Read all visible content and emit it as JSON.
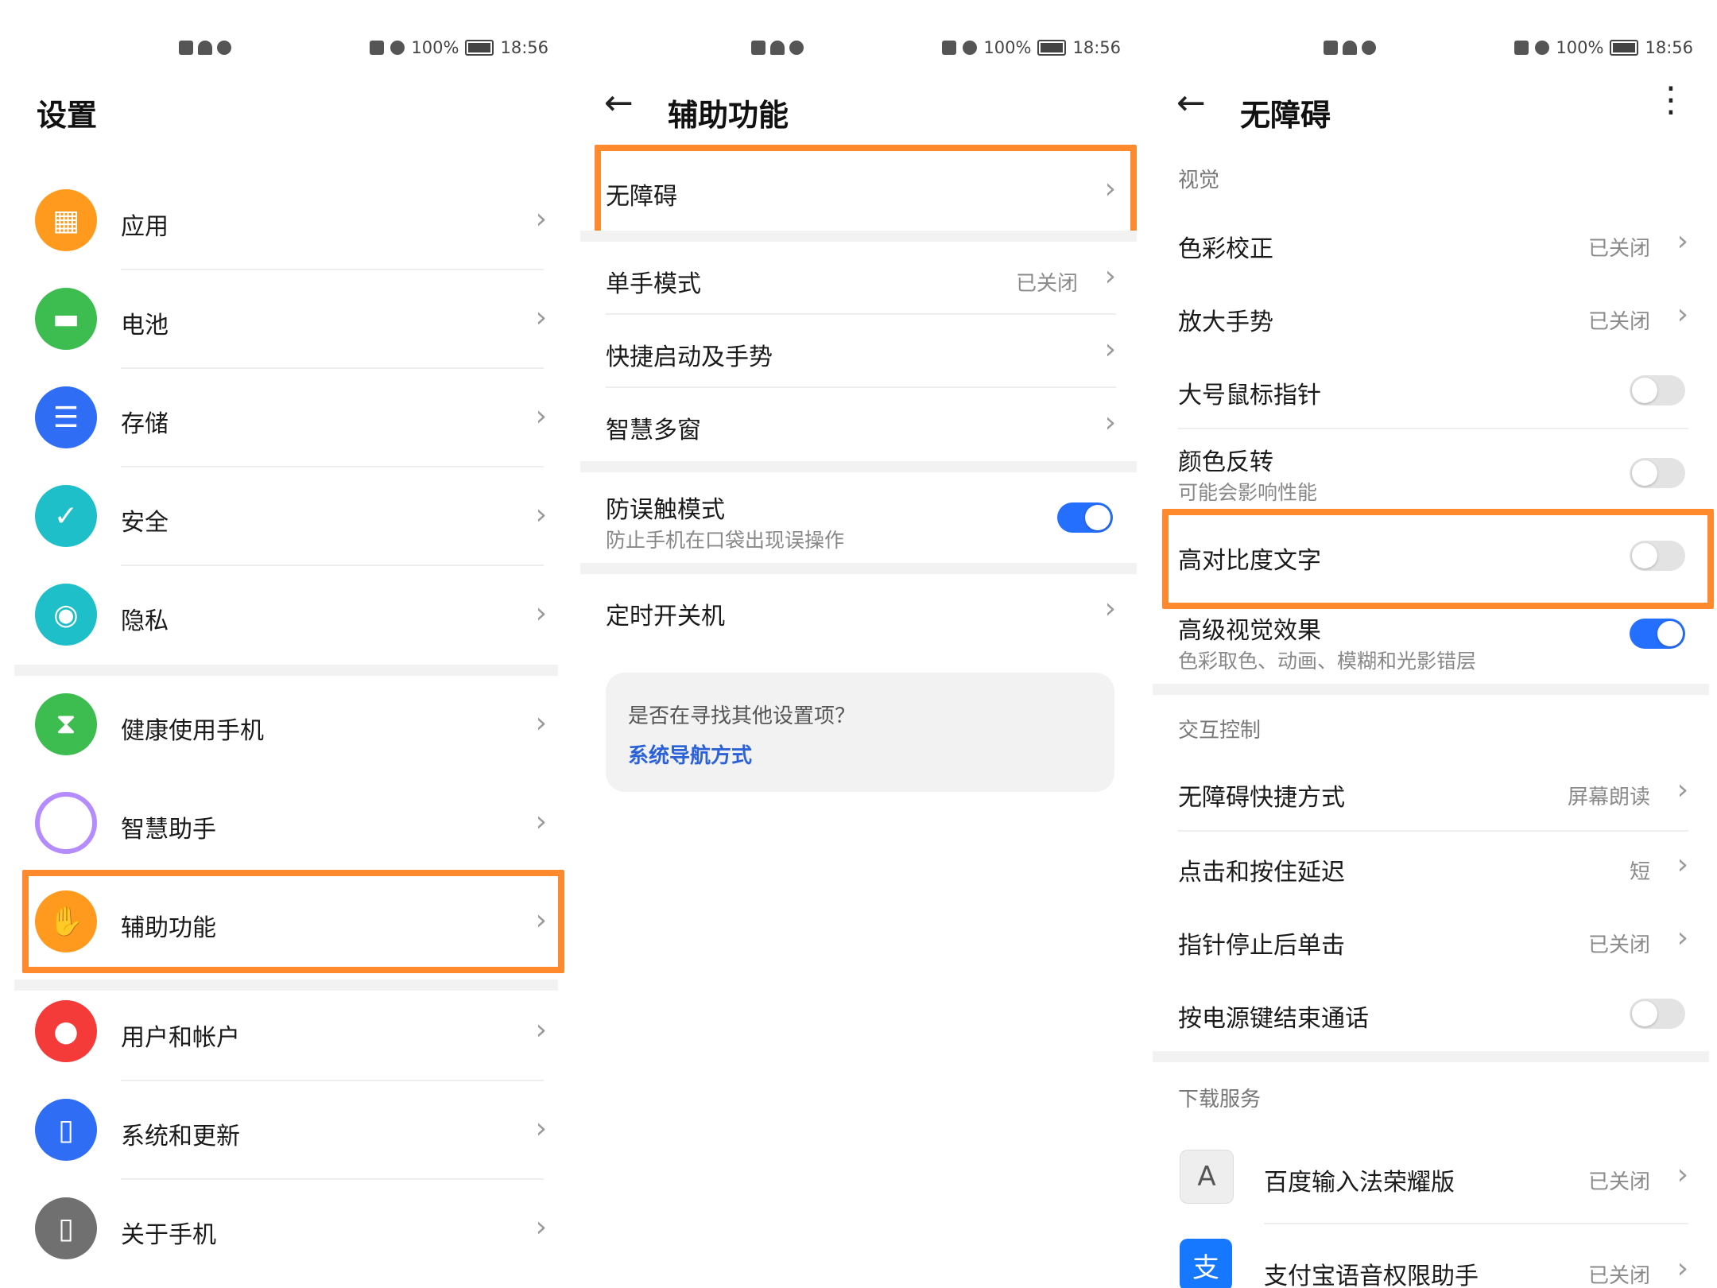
{
  "status_bar": {
    "time": "18:56",
    "battery": "100%"
  },
  "colors": {
    "accent": "#256fff",
    "highlight": "#ff8a2e",
    "link": "#2b62d9"
  },
  "panel1": {
    "title": "设置",
    "items": [
      {
        "label": "应用",
        "icon": "apps-icon",
        "color": "#ff9a1f"
      },
      {
        "label": "电池",
        "icon": "battery-icon",
        "color": "#3dbd4f"
      },
      {
        "label": "存储",
        "icon": "storage-icon",
        "color": "#2f6df5"
      },
      {
        "label": "安全",
        "icon": "shield-icon",
        "color": "#1fbfc9"
      },
      {
        "label": "隐私",
        "icon": "privacy-icon",
        "color": "#1fbfc9"
      },
      {
        "label": "健康使用手机",
        "icon": "hourglass-icon",
        "color": "#3dbd4f"
      },
      {
        "label": "智慧助手",
        "icon": "assistant-icon",
        "color": "#ffffff"
      },
      {
        "label": "辅助功能",
        "icon": "hand-icon",
        "color": "#ff9a1f"
      },
      {
        "label": "用户和帐户",
        "icon": "user-icon",
        "color": "#f53a3a"
      },
      {
        "label": "系统和更新",
        "icon": "system-update-icon",
        "color": "#2f6df5"
      },
      {
        "label": "关于手机",
        "icon": "phone-info-icon",
        "color": "#707070"
      }
    ]
  },
  "panel2": {
    "title": "辅助功能",
    "items": [
      {
        "label": "无障碍"
      },
      {
        "label": "单手模式",
        "value": "已关闭"
      },
      {
        "label": "快捷启动及手势"
      },
      {
        "label": "智慧多窗"
      },
      {
        "label": "防误触模式",
        "sub": "防止手机在口袋出现误操作",
        "toggle": true
      },
      {
        "label": "定时开关机"
      }
    ],
    "search_card": {
      "question": "是否在寻找其他设置项？",
      "link": "系统导航方式"
    }
  },
  "panel3": {
    "title": "无障碍",
    "sections": {
      "visual": "视觉",
      "interaction": "交互控制",
      "download": "下载服务"
    },
    "visual_items": [
      {
        "label": "色彩校正",
        "value": "已关闭"
      },
      {
        "label": "放大手势",
        "value": "已关闭"
      },
      {
        "label": "大号鼠标指针",
        "toggle": false
      },
      {
        "label": "颜色反转",
        "sub": "可能会影响性能",
        "toggle": false
      },
      {
        "label": "高对比度文字",
        "toggle": false
      },
      {
        "label": "高级视觉效果",
        "sub": "色彩取色、动画、模糊和光影错层",
        "toggle": true
      }
    ],
    "interaction_items": [
      {
        "label": "无障碍快捷方式",
        "value": "屏幕朗读"
      },
      {
        "label": "点击和按住延迟",
        "value": "短"
      },
      {
        "label": "指针停止后单击",
        "value": "已关闭"
      },
      {
        "label": "按电源键结束通话",
        "toggle": false
      }
    ],
    "download_items": [
      {
        "label": "百度输入法荣耀版",
        "value": "已关闭",
        "icon_text": "A"
      },
      {
        "label": "支付宝语音权限助手",
        "value": "已关闭",
        "icon_text": "支"
      }
    ]
  }
}
